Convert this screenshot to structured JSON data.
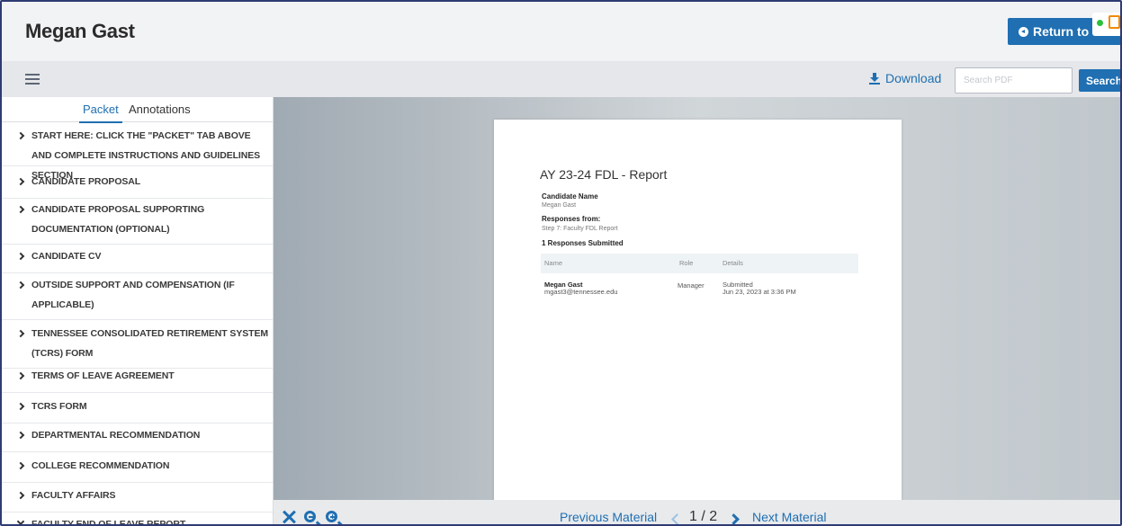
{
  "header": {
    "title": "Megan Gast",
    "return_label": "Return to Ca"
  },
  "toolbar": {
    "download_label": "Download",
    "search_placeholder": "Search PDF",
    "search_label": "Search"
  },
  "sidebar": {
    "tabs": [
      {
        "label": "Packet"
      },
      {
        "label": "Annotations"
      }
    ],
    "items": [
      {
        "label": "START HERE: CLICK THE \"PACKET\" TAB ABOVE AND COMPLETE INSTRUCTIONS AND GUIDELINES SECTION",
        "expanded": false
      },
      {
        "label": "CANDIDATE PROPOSAL",
        "expanded": false
      },
      {
        "label": "CANDIDATE PROPOSAL SUPPORTING DOCUMENTATION (OPTIONAL)",
        "expanded": false
      },
      {
        "label": "CANDIDATE CV",
        "expanded": false
      },
      {
        "label": "OUTSIDE SUPPORT AND COMPENSATION (IF APPLICABLE)",
        "expanded": false
      },
      {
        "label": "TENNESSEE CONSOLIDATED RETIREMENT SYSTEM (TCRS) FORM",
        "expanded": false
      },
      {
        "label": "TERMS OF LEAVE AGREEMENT",
        "expanded": false
      },
      {
        "label": "TCRS FORM",
        "expanded": false
      },
      {
        "label": "DEPARTMENTAL RECOMMENDATION",
        "expanded": false
      },
      {
        "label": "COLLEGE RECOMMENDATION",
        "expanded": false
      },
      {
        "label": "FACULTY AFFAIRS",
        "expanded": false
      },
      {
        "label": "FACULTY END OF LEAVE REPORT",
        "expanded": true
      }
    ]
  },
  "pdf": {
    "title": "AY 23-24 FDL - Report",
    "candidate_name_label": "Candidate Name",
    "candidate_name": "Megan Gast",
    "responses_from_label": "Responses from:",
    "responses_from": "Step 7: Faculty FDL Report",
    "responses_count": "1 Responses Submitted",
    "table": {
      "headers": [
        "Name",
        "Role",
        "Details"
      ],
      "rows": [
        {
          "name": "Megan Gast",
          "email": "mgast3@tennessee.edu",
          "role": "Manager",
          "status": "Submitted",
          "date": "Jun 23, 2023 at 3:36 PM"
        }
      ]
    }
  },
  "footer": {
    "prev_label": "Previous Material",
    "page_current": "1",
    "page_total": "2",
    "page_sep": "/",
    "next_label": "Next Material"
  },
  "icons": [
    "arrow-circle-left-icon",
    "hamburger-icon",
    "download-icon",
    "expand-icon",
    "zoom-out-icon",
    "zoom-in-icon",
    "chevron-left-icon",
    "chevron-right-icon",
    "chevron-right-icon",
    "chevron-down-icon"
  ],
  "colors": {
    "accent": "#1f6fb2",
    "frame": "#2f3b73"
  }
}
